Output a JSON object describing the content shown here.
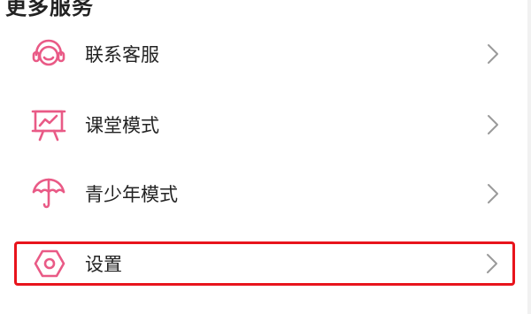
{
  "section": {
    "title": "更多服务"
  },
  "menu": {
    "items": [
      {
        "label": "联系客服",
        "icon": "headset-icon"
      },
      {
        "label": "课堂模式",
        "icon": "presentation-board-icon"
      },
      {
        "label": "青少年模式",
        "icon": "umbrella-icon"
      },
      {
        "label": "设置",
        "icon": "hexagon-gear-icon",
        "highlighted": true
      }
    ]
  },
  "colors": {
    "icon_accent": "#e95a86",
    "highlight_border": "#e8141c",
    "chevron": "#9a9a9a",
    "text": "#222222"
  }
}
